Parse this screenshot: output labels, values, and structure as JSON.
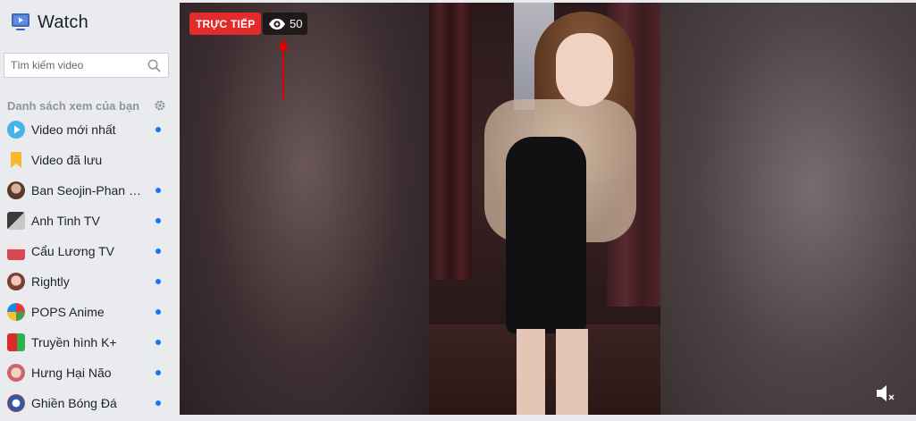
{
  "app": {
    "title": "Watch",
    "icon": "tv-play-icon",
    "accent": "#1877f2"
  },
  "search": {
    "placeholder": "Tìm kiếm video",
    "value": ""
  },
  "watchlist": {
    "heading": "Danh sách xem của bạn",
    "settings_icon": "gear-icon",
    "items": [
      {
        "label": "Video mới nhất",
        "icon": "play-circle-icon",
        "unread": true
      },
      {
        "label": "Video đã lưu",
        "icon": "bookmark-icon",
        "unread": false
      },
      {
        "label": "Ban Seojin-Phan Nam",
        "icon": "avatar",
        "unread": true
      },
      {
        "label": "Anh Tinh TV",
        "icon": "avatar",
        "unread": true
      },
      {
        "label": "Cẩu Lương TV",
        "icon": "avatar",
        "unread": true
      },
      {
        "label": "Rightly",
        "icon": "avatar",
        "unread": true
      },
      {
        "label": "POPS Anime",
        "icon": "avatar",
        "unread": true
      },
      {
        "label": "Truyền hình K+",
        "icon": "avatar",
        "unread": true
      },
      {
        "label": "Hưng Hại Não",
        "icon": "avatar",
        "unread": true
      },
      {
        "label": "Ghiền Bóng Đá",
        "icon": "avatar",
        "unread": true
      }
    ]
  },
  "video": {
    "live_label": "TRỰC TIẾP",
    "viewer_count": "50",
    "viewer_icon": "eye-icon",
    "volume_icon": "volume-muted-icon",
    "live_color": "#e42b2b"
  }
}
